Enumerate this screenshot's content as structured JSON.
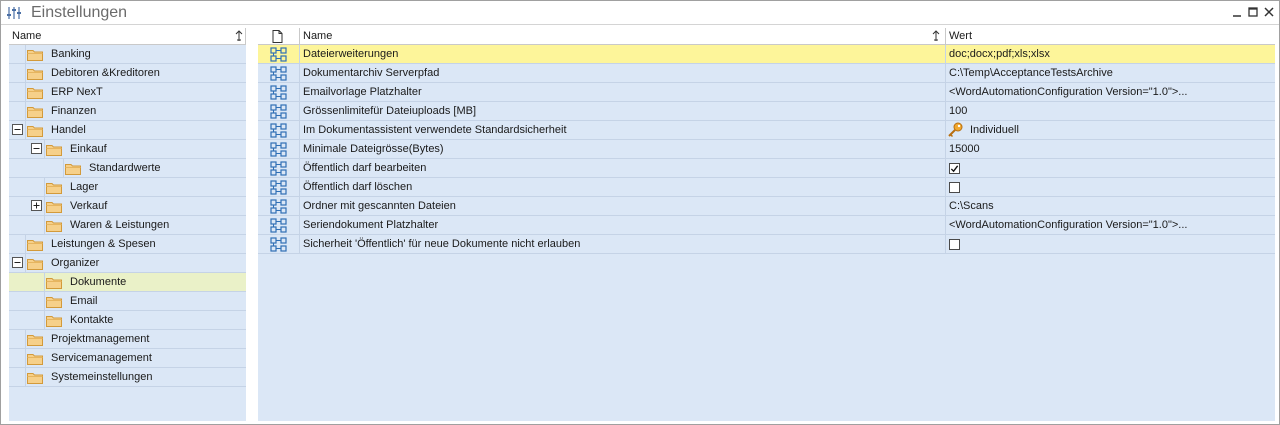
{
  "window": {
    "title": "Einstellungen",
    "controls": [
      "minimize",
      "maximize",
      "close"
    ]
  },
  "tree": {
    "header": "Name",
    "items": [
      {
        "label": "Banking",
        "level": 0,
        "expander": null,
        "selected": false
      },
      {
        "label": "Debitoren &Kreditoren",
        "level": 0,
        "expander": null,
        "selected": false
      },
      {
        "label": "ERP NexT",
        "level": 0,
        "expander": null,
        "selected": false
      },
      {
        "label": "Finanzen",
        "level": 0,
        "expander": null,
        "selected": false
      },
      {
        "label": "Handel",
        "level": 0,
        "expander": "collapse",
        "selected": false
      },
      {
        "label": "Einkauf",
        "level": 1,
        "expander": "collapse",
        "selected": false
      },
      {
        "label": "Standardwerte",
        "level": 2,
        "expander": null,
        "selected": false
      },
      {
        "label": "Lager",
        "level": 1,
        "expander": null,
        "selected": false
      },
      {
        "label": "Verkauf",
        "level": 1,
        "expander": "expand",
        "selected": false
      },
      {
        "label": "Waren & Leistungen",
        "level": 1,
        "expander": null,
        "selected": false
      },
      {
        "label": "Leistungen & Spesen",
        "level": 0,
        "expander": null,
        "selected": false
      },
      {
        "label": "Organizer",
        "level": 0,
        "expander": "collapse",
        "selected": false
      },
      {
        "label": "Dokumente",
        "level": 1,
        "expander": null,
        "selected": true
      },
      {
        "label": "Email",
        "level": 1,
        "expander": null,
        "selected": false
      },
      {
        "label": "Kontakte",
        "level": 1,
        "expander": null,
        "selected": false
      },
      {
        "label": "Projektmanagement",
        "level": 0,
        "expander": null,
        "selected": false
      },
      {
        "label": "Servicemanagement",
        "level": 0,
        "expander": null,
        "selected": false
      },
      {
        "label": "Systemeinstellungen",
        "level": 0,
        "expander": null,
        "selected": false
      }
    ]
  },
  "grid": {
    "columns": {
      "name": "Name",
      "value": "Wert"
    },
    "rows": [
      {
        "name": "Dateierweiterungen",
        "value": "doc;docx;pdf;xls;xlsx",
        "kind": "text",
        "selected": true
      },
      {
        "name": "Dokumentarchiv Serverpfad",
        "value": "C:\\Temp\\AcceptanceTestsArchive",
        "kind": "text",
        "selected": false
      },
      {
        "name": "Emailvorlage Platzhalter",
        "value": "<WordAutomationConfiguration Version=\"1.0\">...",
        "kind": "text",
        "selected": false
      },
      {
        "name": "Grössenlimitefür Dateiuploads [MB]",
        "value": "100",
        "kind": "text",
        "selected": false
      },
      {
        "name": "Im Dokumentassistent verwendete Standardsicherheit",
        "value": "Individuell",
        "kind": "key",
        "selected": false
      },
      {
        "name": "Minimale Dateigrösse(Bytes)",
        "value": "15000",
        "kind": "text",
        "selected": false
      },
      {
        "name": "Öffentlich darf bearbeiten",
        "value": true,
        "kind": "checkbox",
        "selected": false
      },
      {
        "name": "Öffentlich darf löschen",
        "value": false,
        "kind": "checkbox",
        "selected": false
      },
      {
        "name": "Ordner mit gescannten Dateien",
        "value": "C:\\Scans",
        "kind": "text",
        "selected": false
      },
      {
        "name": "Seriendokument Platzhalter",
        "value": "<WordAutomationConfiguration Version=\"1.0\">...",
        "kind": "text",
        "selected": false
      },
      {
        "name": "Sicherheit 'Öffentlich' für neue Dokumente nicht erlauben",
        "value": false,
        "kind": "checkbox",
        "selected": false
      }
    ]
  },
  "colors": {
    "panel_bg": "#dbe7f6",
    "tree_selected": "#eaf1c8",
    "grid_selected": "#fdf59a",
    "folder": "#f6d08a",
    "prop_icon": "#2f6fb5"
  }
}
